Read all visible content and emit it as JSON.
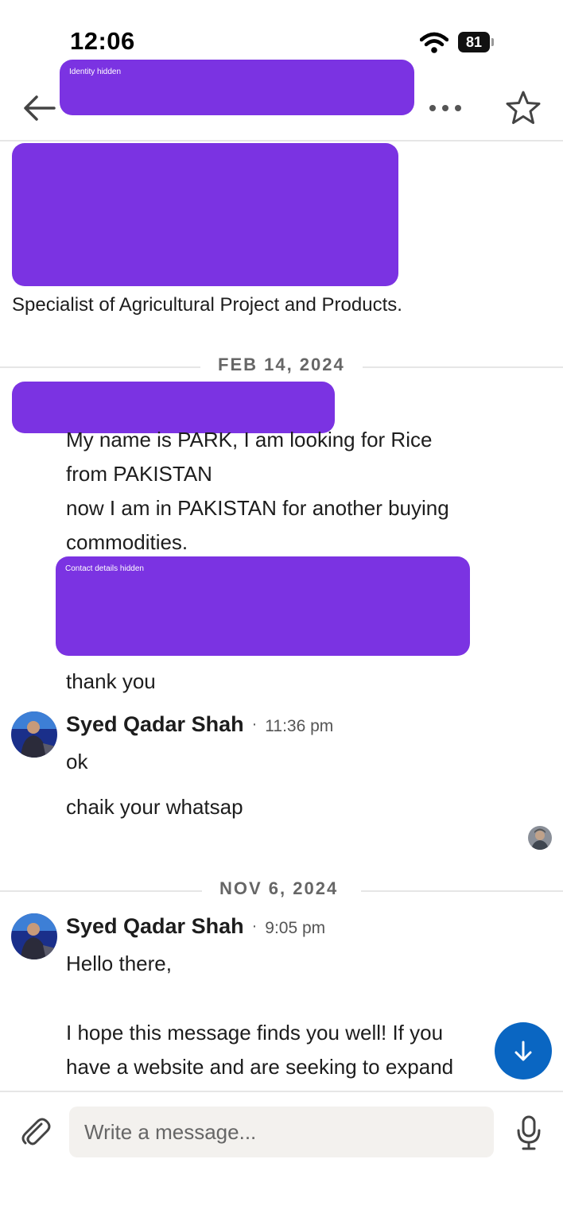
{
  "status_bar": {
    "time": "12:06",
    "battery": "81"
  },
  "header": {
    "redaction_label": "Identity hidden",
    "icons": {
      "back": "arrow-left-icon",
      "more": "more-horizontal-icon",
      "star": "star-outline-icon"
    }
  },
  "profile": {
    "headline": "Specialist of Agricultural Project and Products."
  },
  "conversation": {
    "dates": [
      "FEB 14, 2024",
      "NOV 6, 2024"
    ],
    "first_message_lines": [
      "My name is PARK, I am looking for Rice",
      "from PAKISTAN",
      "now I am in PAKISTAN for another buying",
      "commodities."
    ],
    "contact_redaction_label": "Contact details hidden",
    "closing_line": "thank you",
    "reply_group_1": {
      "sender": "Syed Qadar Shah",
      "separator": "·",
      "time": "11:36 pm",
      "messages": [
        "ok",
        "chaik your whatsap"
      ]
    },
    "reply_group_2": {
      "sender": "Syed Qadar Shah",
      "separator": "·",
      "time": "9:05 pm",
      "lines": [
        "Hello there,",
        "I hope this message finds you well! If you",
        "have a website and are seeking to expand"
      ]
    }
  },
  "composer": {
    "placeholder": "Write a message..."
  },
  "colors": {
    "redaction": "#7b33e2",
    "accent_blue": "#0a66c2",
    "input_bg": "#f3f1ee"
  }
}
